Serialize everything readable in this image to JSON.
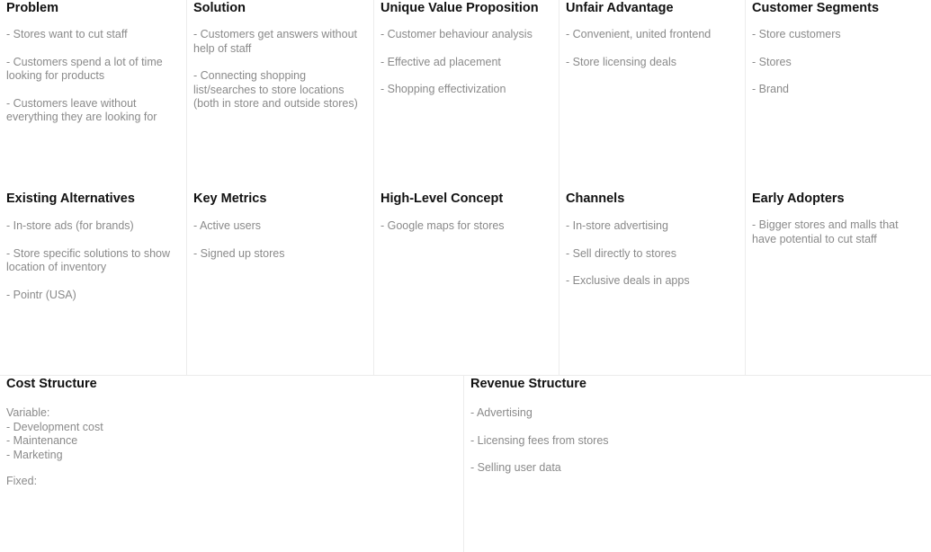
{
  "problem": {
    "title": "Problem",
    "items": [
      "- Stores want to cut staff",
      "- Customers spend a lot of time looking for products",
      "- Customers leave without everything they are looking for"
    ]
  },
  "solution": {
    "title": "Solution",
    "items": [
      "- Customers get answers without help of staff",
      "- Connecting shopping list/searches to store locations (both in store and outside stores)"
    ]
  },
  "uvp": {
    "title": "Unique Value Proposition",
    "items": [
      "- Customer behaviour analysis",
      "- Effective ad placement",
      "- Shopping effectivization"
    ]
  },
  "unfair_advantage": {
    "title": "Unfair Advantage",
    "items": [
      "- Convenient, united frontend",
      "- Store licensing deals"
    ]
  },
  "customer_segments": {
    "title": "Customer Segments",
    "items": [
      "- Store customers",
      "- Stores",
      "- Brand"
    ]
  },
  "existing_alternatives": {
    "title": "Existing Alternatives",
    "items": [
      "- In-store ads (for brands)",
      "- Store specific solutions to show location of inventory",
      "- Pointr (USA)"
    ]
  },
  "key_metrics": {
    "title": "Key Metrics",
    "items": [
      "- Active users",
      "- Signed up stores"
    ]
  },
  "high_level_concept": {
    "title": "High-Level Concept",
    "items": [
      "- Google maps for stores"
    ]
  },
  "channels": {
    "title": "Channels",
    "items": [
      "- In-store advertising",
      "- Sell directly to stores",
      "- Exclusive deals in apps"
    ]
  },
  "early_adopters": {
    "title": "Early Adopters",
    "items": [
      "- Bigger stores and malls that have potential to cut staff"
    ]
  },
  "cost_structure": {
    "title": "Cost Structure",
    "variable_label": "Variable:",
    "variable_items": [
      "- Development cost",
      "- Maintenance",
      "- Marketing"
    ],
    "fixed_label": "Fixed:"
  },
  "revenue_structure": {
    "title": "Revenue Structure",
    "items": [
      "- Advertising",
      "- Licensing fees from stores",
      "- Selling user data"
    ]
  }
}
